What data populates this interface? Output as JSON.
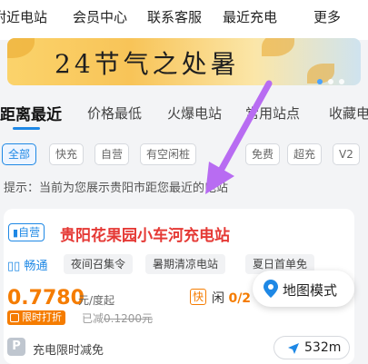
{
  "top_nav": {
    "items": [
      "附近电站",
      "会员中心",
      "联系客服",
      "最近充电",
      "更多"
    ]
  },
  "banner": {
    "title": "24节气之处暑"
  },
  "tabs": [
    "距离最近",
    "价格最低",
    "火爆电站",
    "常用站点",
    "收藏电"
  ],
  "filters": [
    "全部",
    "快充",
    "自营",
    "有空闲桩",
    "免费",
    "超充",
    "V2"
  ],
  "hint": "提示：当前为您展示贵阳市距您最近的电站",
  "station": {
    "badge": "自营",
    "name": "贵阳花果园小车河充电站",
    "smooth_label": "畅通",
    "tags": [
      "夜间召集令",
      "暑期清凉电站",
      "夏日首单免"
    ],
    "price": "0.7780",
    "price_unit": "元/度起",
    "fast_label": "快",
    "idle_prefix": "闲",
    "idle_count": "0/2",
    "promo_label": "限时打折",
    "saved_prefix": "已减",
    "saved_amount": "0.1200元",
    "limit_text": "充电限时减免",
    "distance": "532m"
  },
  "map_mode_label": "地图模式",
  "colors": {
    "accent_blue": "#1e88e5",
    "price_orange": "#f57c00",
    "station_red": "#e53935",
    "annotation_purple": "#b86cf2"
  }
}
